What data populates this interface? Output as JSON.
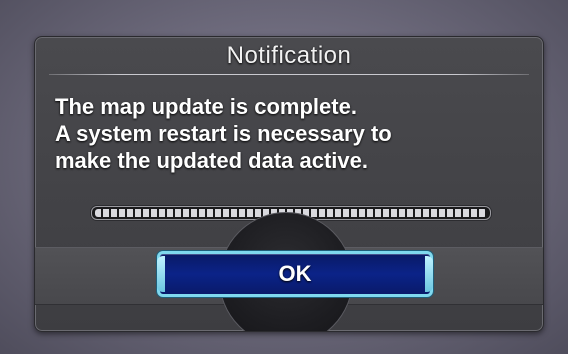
{
  "dialog": {
    "title": "Notification",
    "message_lines": [
      "The map update is complete.",
      "A system restart is necessary to",
      "make the updated data active."
    ],
    "progress": {
      "fraction": 1.0
    },
    "ok_label": "OK"
  },
  "colors": {
    "accent": "#7fd8ee",
    "button_fill": "#0b2388",
    "panel": "#444448"
  }
}
